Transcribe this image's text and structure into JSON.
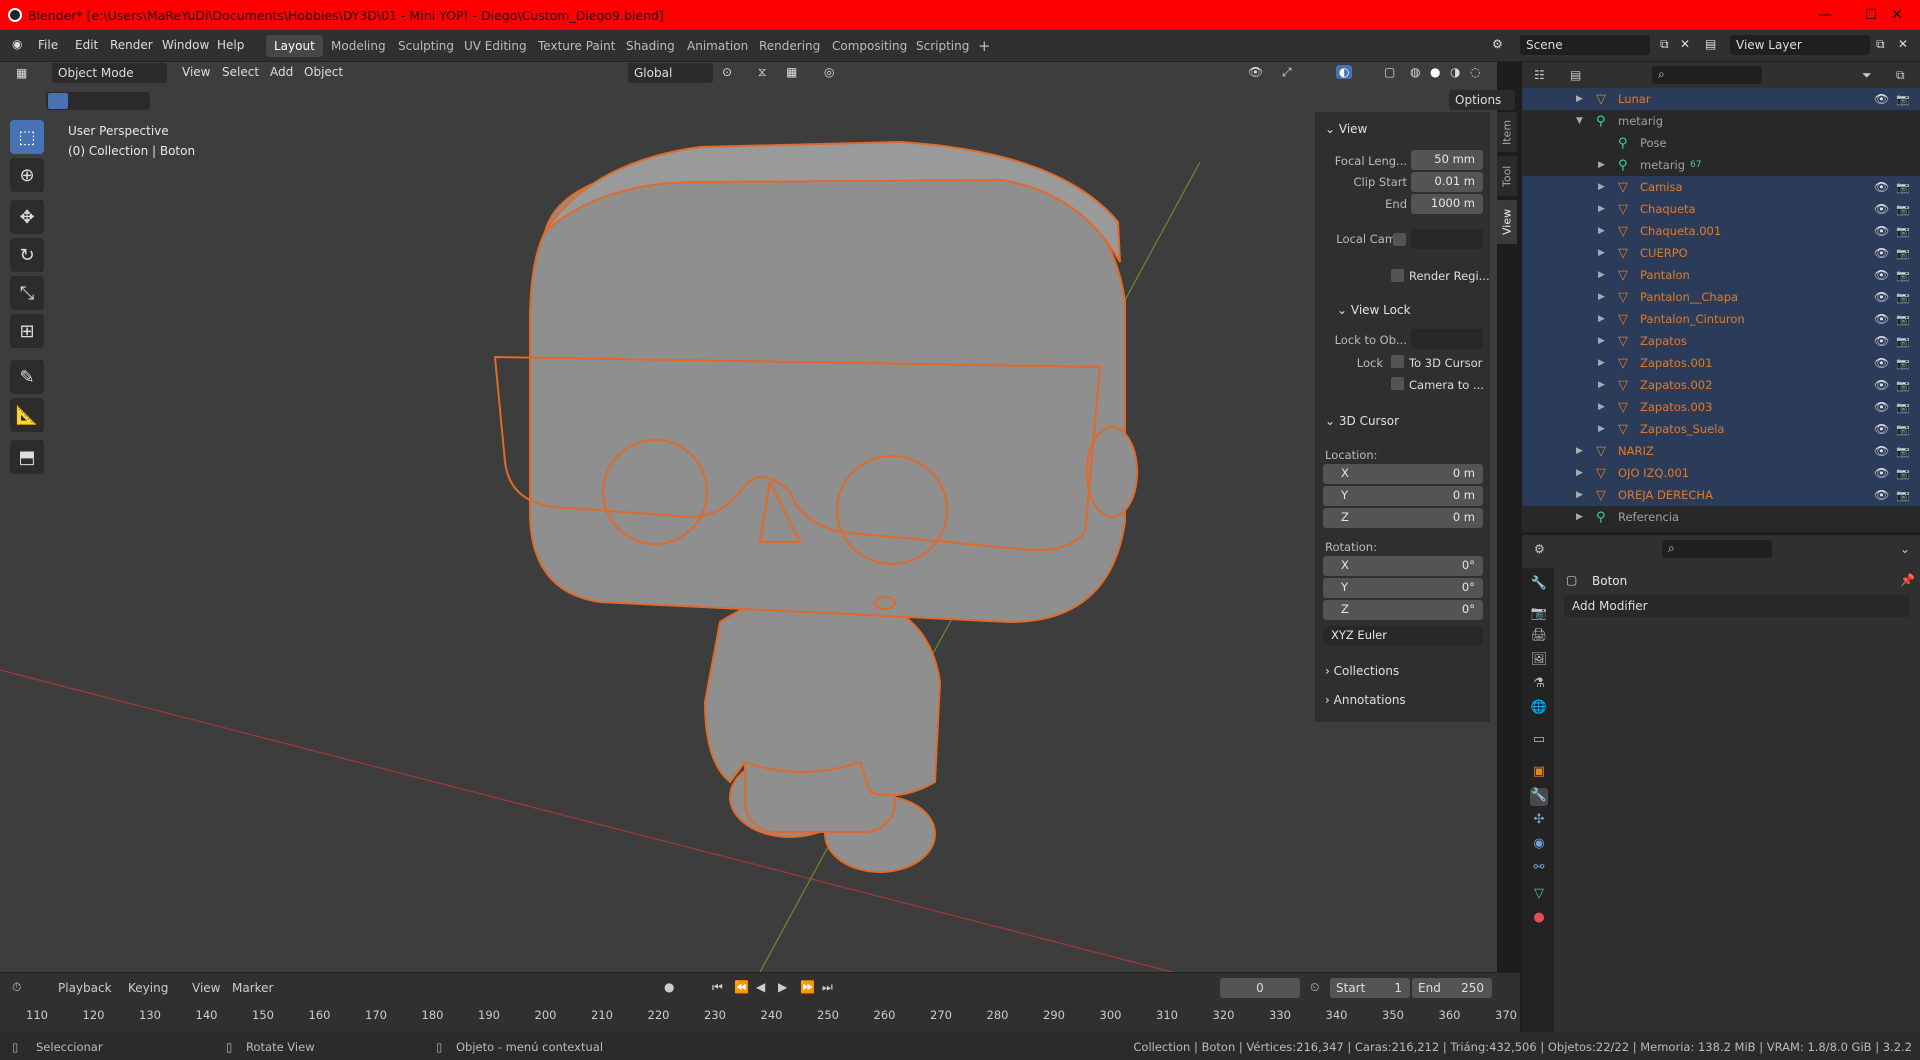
{
  "window": {
    "title": "Blender* [e:\\Users\\MaReYuDi\\Documents\\Hobbies\\DY3D\\01 - Mini YOP! - Diego\\Custom_Diego9.blend]",
    "minimize": "—",
    "maximize": "☐",
    "close": "✕"
  },
  "menu": [
    "File",
    "Edit",
    "Render",
    "Window",
    "Help"
  ],
  "workspaces": [
    "Layout",
    "Modeling",
    "Sculpting",
    "UV Editing",
    "Texture Paint",
    "Shading",
    "Animation",
    "Rendering",
    "Compositing",
    "Scripting"
  ],
  "add_workspace": "+",
  "scene": "Scene",
  "view_layer": "View Layer",
  "viewport": {
    "mode": "Object Mode",
    "menus": [
      "View",
      "Select",
      "Add",
      "Object"
    ],
    "orientation": "Global",
    "options": "Options",
    "overlay_title": "User Perspective",
    "overlay_collection": "(0) Collection | Boton"
  },
  "npanel": {
    "view_header": "View",
    "focal_label": "Focal Leng...",
    "focal": "50 mm",
    "clip_start_label": "Clip Start",
    "clip_start": "0.01 m",
    "end_label": "End",
    "end": "1000 m",
    "local_cam": "Local Cam...",
    "render_region": "Render Regi...",
    "view_lock": "View Lock",
    "lock_to_ob": "Lock to Ob...",
    "lock": "Lock",
    "to_3d_cursor": "To 3D Cursor",
    "camera_to": "Camera to ...",
    "cursor_header": "3D Cursor",
    "location": "Location:",
    "loc": [
      {
        "a": "X",
        "v": "0 m"
      },
      {
        "a": "Y",
        "v": "0 m"
      },
      {
        "a": "Z",
        "v": "0 m"
      }
    ],
    "rotation": "Rotation:",
    "rot": [
      {
        "a": "X",
        "v": "0°"
      },
      {
        "a": "Y",
        "v": "0°"
      },
      {
        "a": "Z",
        "v": "0°"
      }
    ],
    "euler": "XYZ Euler",
    "collections": "Collections",
    "annotations": "Annotations"
  },
  "side_tabs": [
    "Item",
    "Tool",
    "View"
  ],
  "outliner": [
    {
      "name": "Lunar",
      "depth": 1,
      "sel": true
    },
    {
      "name": "metarig",
      "depth": 1,
      "grey": true,
      "open": true
    },
    {
      "name": "Pose",
      "depth": 2,
      "grey": true,
      "nt": true
    },
    {
      "name": "metarig",
      "depth": 2,
      "grey": true,
      "badge": "67"
    },
    {
      "name": "Camisa",
      "depth": 2,
      "sel": true
    },
    {
      "name": "Chaqueta",
      "depth": 2,
      "sel": true
    },
    {
      "name": "Chaqueta.001",
      "depth": 2,
      "sel": true
    },
    {
      "name": "CUERPO",
      "depth": 2,
      "sel": true
    },
    {
      "name": "Pantalon",
      "depth": 2,
      "sel": true
    },
    {
      "name": "Pantalon__Chapa",
      "depth": 2,
      "sel": true
    },
    {
      "name": "Pantalon_Cinturon",
      "depth": 2,
      "sel": true
    },
    {
      "name": "Zapatos",
      "depth": 2,
      "sel": true
    },
    {
      "name": "Zapatos.001",
      "depth": 2,
      "sel": true
    },
    {
      "name": "Zapatos.002",
      "depth": 2,
      "sel": true
    },
    {
      "name": "Zapatos.003",
      "depth": 2,
      "sel": true
    },
    {
      "name": "Zapatos_Suela",
      "depth": 2,
      "sel": true
    },
    {
      "name": "NARIZ",
      "depth": 1,
      "sel": true
    },
    {
      "name": "OJO IZQ.001",
      "depth": 1,
      "sel": true
    },
    {
      "name": "OREJA DERECHA",
      "depth": 1,
      "sel": true
    },
    {
      "name": "Referencia",
      "depth": 1,
      "grey": true
    }
  ],
  "properties": {
    "object": "Boton",
    "add_modifier": "Add Modifier"
  },
  "timeline": {
    "menus": [
      "Playback",
      "Keying",
      "View",
      "Marker"
    ],
    "frame": "0",
    "start_label": "Start",
    "start": "1",
    "end_label": "End",
    "end": "250",
    "ticks": [
      "110",
      "120",
      "130",
      "140",
      "150",
      "160",
      "170",
      "180",
      "190",
      "200",
      "210",
      "220",
      "230",
      "240",
      "250",
      "260",
      "270",
      "280",
      "290",
      "300",
      "310",
      "320",
      "330",
      "340",
      "350",
      "360",
      "370"
    ]
  },
  "status": {
    "select": "Seleccionar",
    "rotate": "Rotate View",
    "context": "Objeto - menú contextual",
    "stats": "Collection | Boton | Vértices:216,347 | Caras:216,212 | Triáng:432,506 | Objetos:22/22 | Memoria: 138.2 MiB | VRAM: 1.8/8.0 GiB | 3.2.2"
  },
  "colors": {
    "accent": "#4772b3",
    "selected_outline": "#e06a2a",
    "title_bar": "#ff0000"
  }
}
